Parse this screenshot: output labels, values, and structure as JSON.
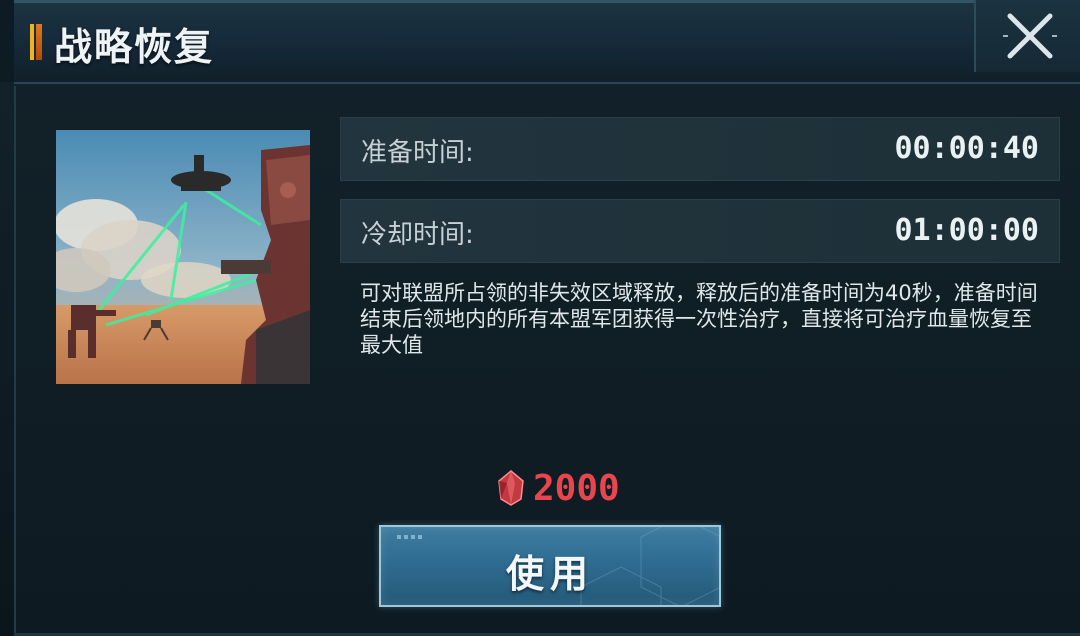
{
  "dialog": {
    "title": "战略恢复",
    "close_icon": "close-x-icon"
  },
  "stats": [
    {
      "label": "准备时间:",
      "value": "00:00:40"
    },
    {
      "label": "冷却时间:",
      "value": "01:00:00"
    }
  ],
  "description": "可对联盟所占领的非失效区域释放，释放后的准备时间为40秒，准备时间结束后领地内的所有本盟军团获得一次性治疗，直接将可治疗血量恢复至最大值",
  "cost": {
    "icon": "red-crystal-icon",
    "value": "2000",
    "color": "#e8464f"
  },
  "use_button": {
    "label": "使用"
  },
  "colors": {
    "accent_yellow": "#f2b21c",
    "accent_orange": "#e07a17",
    "button_blue": "#2e6a8f"
  }
}
